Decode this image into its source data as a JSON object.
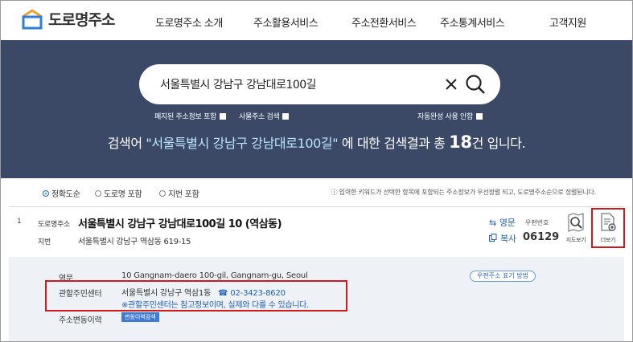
{
  "header": {
    "logo_text": "도로명주소",
    "nav": [
      "도로명주소 소개",
      "주소활용서비스",
      "주소전환서비스",
      "주소통계서비스",
      "고객지원"
    ]
  },
  "search": {
    "value": "서울특별시 강남구 강남대로100길",
    "options": {
      "abolished": "폐지된 주소정보 포함",
      "reason": "사물주소 검색",
      "autocomplete": "자동완성 사용 안함"
    },
    "result_prefix": "검색어 ",
    "result_query": "\"서울특별시 강남구 강남대로100길\"",
    "result_mid": " 에 대한 검색결과 총 ",
    "result_count": "18",
    "result_suffix": "건 입니다."
  },
  "sort": {
    "options": [
      "정확도순",
      "도로명 포함",
      "지번 포함"
    ],
    "selected": "정확도순",
    "info": "ⓘ 입력한 키워드가 선택한 항목에 포함되는 주소정보가 우선정렬 되고, 도로명주소순으로 정렬된니다."
  },
  "result": {
    "number": "1",
    "road_label": "도로명주소",
    "road_address": "서울특별시 강남구 강남대로100길 10 (역삼동)",
    "jibun_label": "지번",
    "jibun_address": "서울특별시 강남구 역삼동 619-15",
    "english_btn": "영문",
    "copy_btn": "복사",
    "postcode_label": "우편번호",
    "postcode": "06129",
    "map_btn": "지도보기",
    "more_btn": "더보기"
  },
  "detail": {
    "english_label": "영문",
    "english_value": "10 Gangnam-daero 100-gil, Gangnam-gu, Seoul",
    "postal_guide": "우편주소 표기 방법",
    "center_label": "관할주민센터",
    "center_name": "서울특별시 강남구 역삼1동",
    "center_tel": "☎ 02-3423-8620",
    "center_note": "※관할주민센터는 참고정보이며, 실제와 다를 수 있습니다.",
    "history_label": "주소변동이력",
    "history_btn": "변동이력검색"
  },
  "colors": {
    "banner": "#3b4967",
    "accent": "#1f5fb4",
    "highlight": "#d01919"
  }
}
